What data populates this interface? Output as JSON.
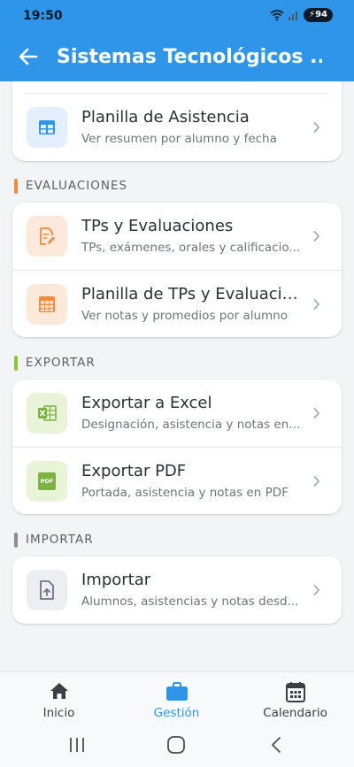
{
  "status_bar": {
    "time": "19:50",
    "battery": "94"
  },
  "app_bar": {
    "title": "Sistemas Tecnológicos ..."
  },
  "items": {
    "asistencia": {
      "title": "Planilla de Asistencia",
      "subtitle": "Ver resumen por alumno y fecha",
      "icon": "table-icon"
    },
    "tps": {
      "title": "TPs y Evaluaciones",
      "subtitle": "TPs, exámenes, orales y calificacio...",
      "icon": "edit-document-icon"
    },
    "planilla_tps": {
      "title": "Planilla de TPs y Evaluacio...",
      "subtitle": "Ver notas y promedios por alumno",
      "icon": "grid-icon"
    },
    "excel": {
      "title": "Exportar a Excel",
      "subtitle": "Designación, asistencia y notas en...",
      "icon": "excel-icon"
    },
    "pdf": {
      "title": "Exportar PDF",
      "subtitle": "Portada, asistencia y notas en PDF",
      "icon": "pdf-icon",
      "badge": "PDF"
    },
    "importar": {
      "title": "Importar",
      "subtitle": "Alumnos, asistencias y notas desd...",
      "icon": "upload-file-icon"
    }
  },
  "sections": {
    "evaluaciones": {
      "label": "EVALUACIONES",
      "color": "#f28b3c"
    },
    "exportar": {
      "label": "EXPORTAR",
      "color": "#8cc63f"
    },
    "importar": {
      "label": "IMPORTAR",
      "color": "#8a9099"
    }
  },
  "bottom_nav": {
    "inicio": "Inicio",
    "gestion": "Gestión",
    "calendario": "Calendario",
    "active": "gestion"
  },
  "colors": {
    "primary": "#2e95e8",
    "blue_tile": "#e3effb",
    "orange_tile": "#fde9dc",
    "green_tile": "#e9f3d8",
    "gray_tile": "#eceef1"
  }
}
